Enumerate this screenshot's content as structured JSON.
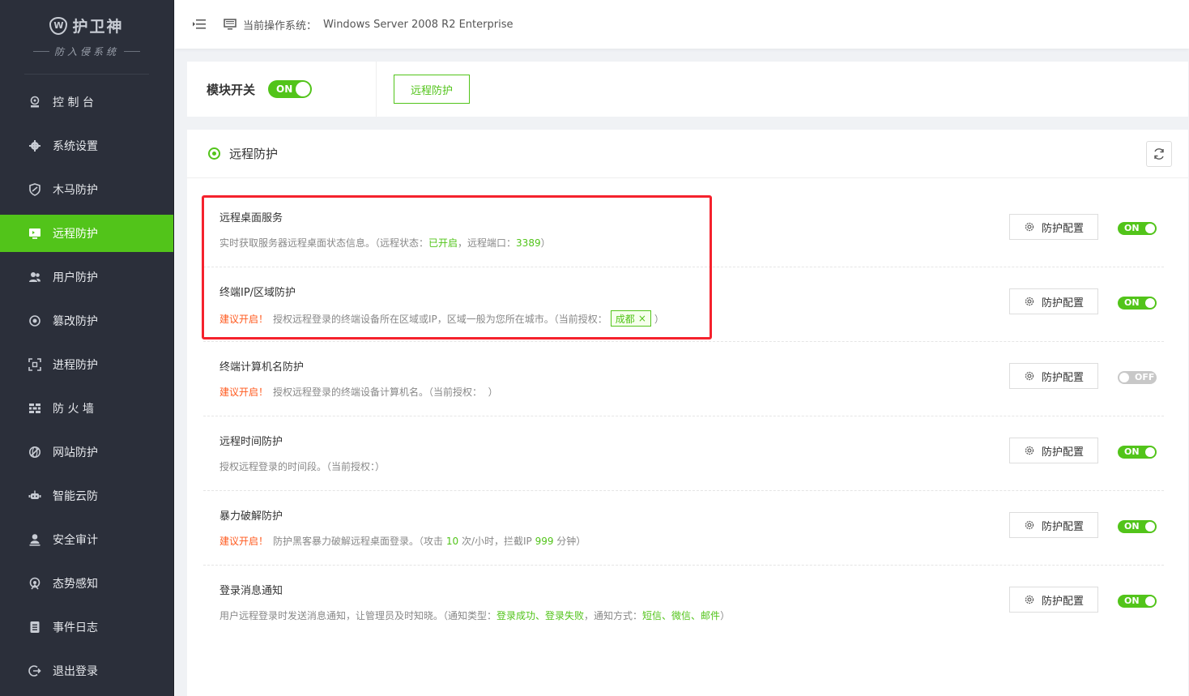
{
  "sidebar": {
    "logo_title": "护卫神",
    "logo_badge": "W",
    "logo_subtitle": "防入侵系统",
    "items": [
      {
        "label": "控 制 台",
        "icon": "dashboard-icon"
      },
      {
        "label": "系统设置",
        "icon": "gear-icon"
      },
      {
        "label": "木马防护",
        "icon": "shield-icon"
      },
      {
        "label": "远程防护",
        "icon": "remote-desktop-icon"
      },
      {
        "label": "用户防护",
        "icon": "users-icon"
      },
      {
        "label": "篡改防护",
        "icon": "tamper-icon"
      },
      {
        "label": "进程防护",
        "icon": "process-icon"
      },
      {
        "label": "防 火 墙",
        "icon": "firewall-icon"
      },
      {
        "label": "网站防护",
        "icon": "web-icon"
      },
      {
        "label": "智能云防",
        "icon": "cloud-robot-icon"
      },
      {
        "label": "安全审计",
        "icon": "audit-icon"
      },
      {
        "label": "态势感知",
        "icon": "radar-icon"
      },
      {
        "label": "事件日志",
        "icon": "log-icon"
      },
      {
        "label": "退出登录",
        "icon": "logout-icon"
      }
    ],
    "active_index": 3
  },
  "topbar": {
    "os_label": "当前操作系统：",
    "os_value": "Windows Server 2008 R2 Enterprise"
  },
  "module": {
    "label": "模块开关",
    "switch_state": "ON",
    "tab_label": "远程防护"
  },
  "section": {
    "title": "远程防护"
  },
  "rows": [
    {
      "title": "远程桌面服务",
      "desc_parts": [
        {
          "text": "实时获取服务器远程桌面状态信息。（远程状态：",
          "style": "normal"
        },
        {
          "text": "已开启",
          "style": "green"
        },
        {
          "text": "，远程端口：",
          "style": "normal"
        },
        {
          "text": "3389",
          "style": "green"
        },
        {
          "text": "）",
          "style": "normal"
        }
      ],
      "button": "防护配置",
      "switch": "ON"
    },
    {
      "title": "终端IP/区域防护",
      "desc_parts": [
        {
          "text": "建议开启！",
          "style": "warn"
        },
        {
          "text": "授权远程登录的终端设备所在区域或IP，区域一般为您所在城市。（当前授权：",
          "style": "normal"
        },
        {
          "text": "成都",
          "style": "tag"
        },
        {
          "text": "）",
          "style": "normal"
        }
      ],
      "button": "防护配置",
      "switch": "ON"
    },
    {
      "title": "终端计算机名防护",
      "desc_parts": [
        {
          "text": "建议开启！",
          "style": "warn"
        },
        {
          "text": "授权远程登录的终端设备计算机名。（当前授权：  ）",
          "style": "normal"
        }
      ],
      "button": "防护配置",
      "switch": "OFF"
    },
    {
      "title": "远程时间防护",
      "desc_parts": [
        {
          "text": "授权远程登录的时间段。（当前授权：）",
          "style": "normal"
        }
      ],
      "button": "防护配置",
      "switch": "ON"
    },
    {
      "title": "暴力破解防护",
      "desc_parts": [
        {
          "text": "建议开启！",
          "style": "warn"
        },
        {
          "text": "防护黑客暴力破解远程桌面登录。（攻击 ",
          "style": "normal"
        },
        {
          "text": "10",
          "style": "green"
        },
        {
          "text": " 次/小时，拦截IP ",
          "style": "normal"
        },
        {
          "text": "999",
          "style": "green"
        },
        {
          "text": " 分钟）",
          "style": "normal"
        }
      ],
      "button": "防护配置",
      "switch": "ON"
    },
    {
      "title": "登录消息通知",
      "desc_parts": [
        {
          "text": "用户远程登录时发送消息通知，让管理员及时知晓。（通知类型：",
          "style": "normal"
        },
        {
          "text": "登录成功、登录失败",
          "style": "green"
        },
        {
          "text": "，通知方式：",
          "style": "normal"
        },
        {
          "text": "短信、微信、邮件",
          "style": "green"
        },
        {
          "text": "）",
          "style": "normal"
        }
      ],
      "button": "防护配置",
      "switch": "ON"
    }
  ],
  "colors": {
    "accent": "#52c41a",
    "sidebar_bg": "#2b2f3a",
    "warn": "#ff5a1f",
    "highlight": "#f5222d"
  }
}
